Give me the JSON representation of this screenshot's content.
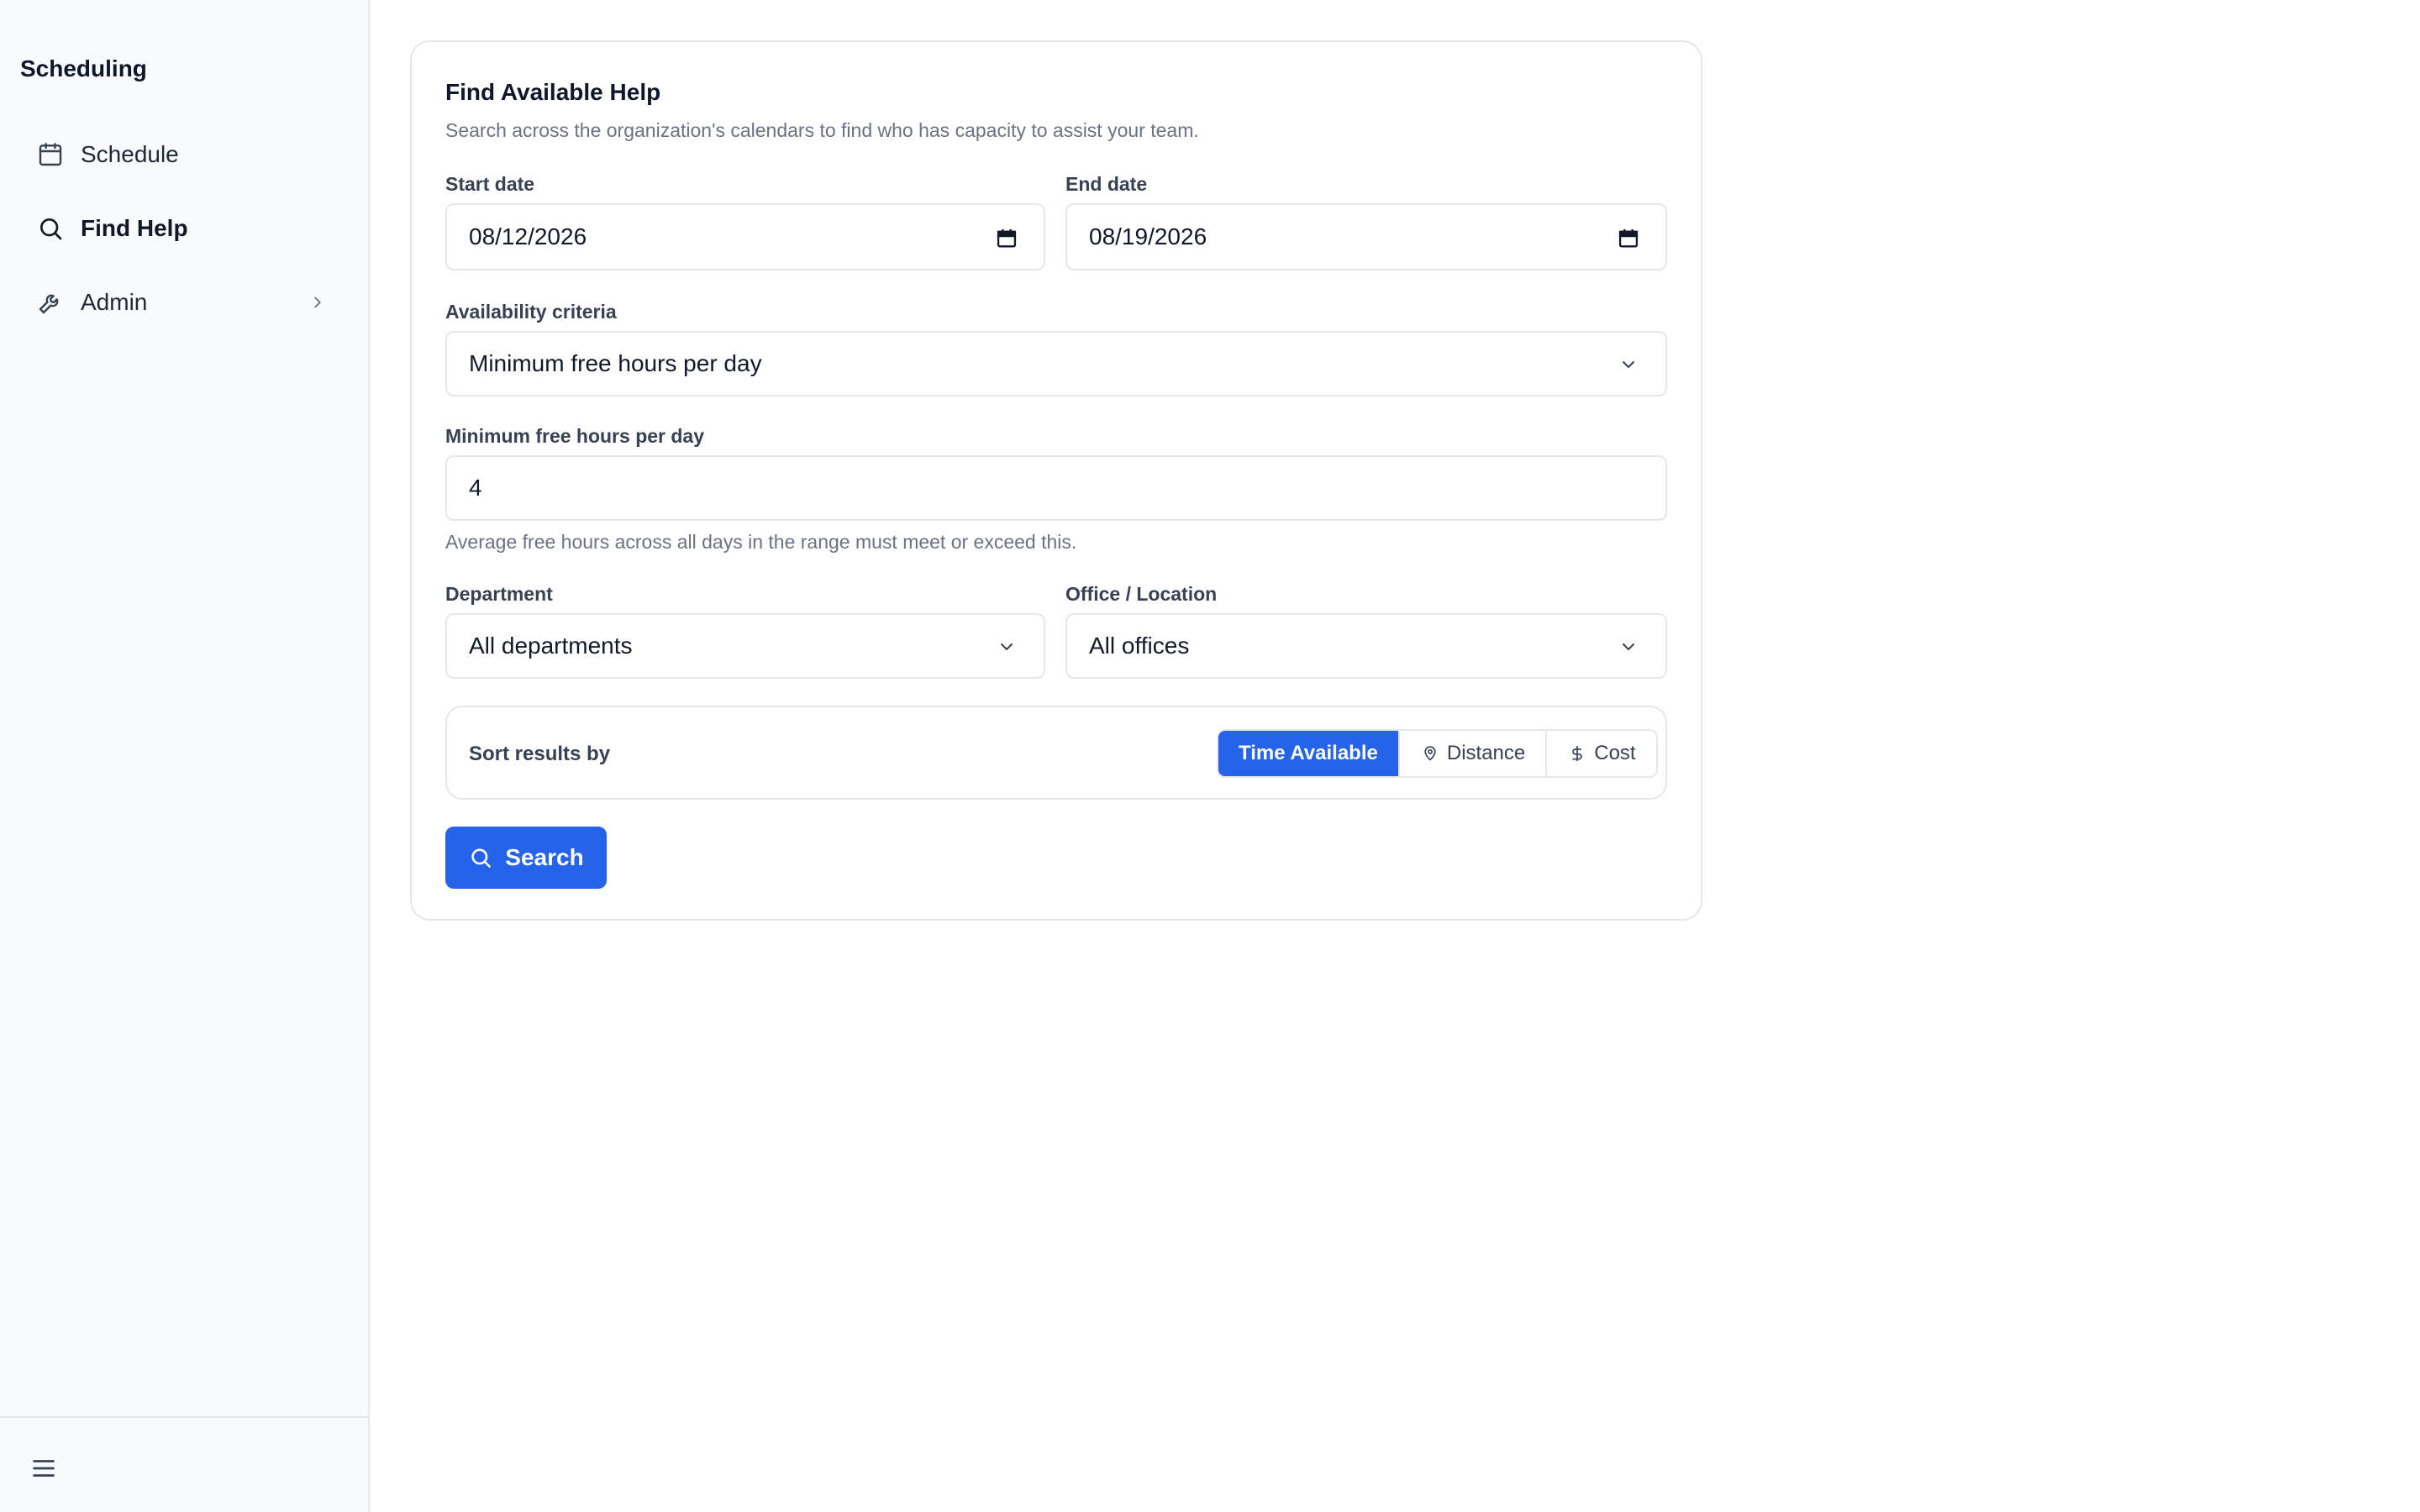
{
  "sidebar": {
    "brand": "Scheduling",
    "items": [
      {
        "label": "Schedule",
        "icon": "calendar-icon"
      },
      {
        "label": "Find Help",
        "icon": "search-icon",
        "active": true
      },
      {
        "label": "Admin",
        "icon": "wrench-icon",
        "has_submenu": true
      }
    ],
    "footer_icon": "menu-icon"
  },
  "form": {
    "title": "Find Available Help",
    "subtitle": "Search across the organization's calendars to find who has capacity to assist your team.",
    "start_date_label": "Start date",
    "start_date_value": "08/12/2026",
    "end_date_label": "End date",
    "end_date_value": "08/19/2026",
    "criteria_label": "Availability criteria",
    "criteria_value": "Minimum free hours per day",
    "min_hours_label": "Minimum free hours per day",
    "min_hours_value": "4",
    "min_hours_hint": "Average free hours across all days in the range must meet or exceed this.",
    "department_label": "Department",
    "department_value": "All departments",
    "office_label": "Office / Location",
    "office_value": "All offices",
    "sort_label": "Sort results by",
    "sort_options": [
      {
        "label": "Time Available",
        "active": true
      },
      {
        "label": "Distance",
        "icon": "map-pin-icon"
      },
      {
        "label": "Cost",
        "icon": "dollar-icon"
      }
    ],
    "search_label": "Search"
  },
  "colors": {
    "accent": "#2563eb",
    "sidebar_bg": "#f8fafc",
    "border": "#e5e7eb",
    "muted_text": "#6b7280"
  }
}
